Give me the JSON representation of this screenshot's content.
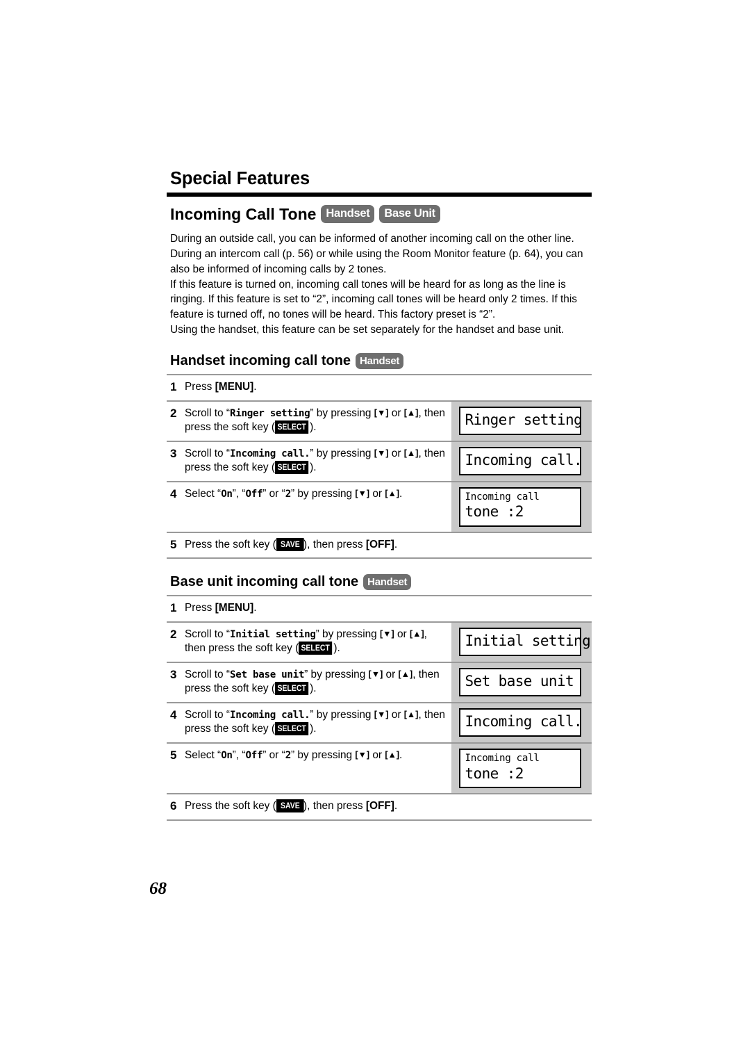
{
  "document": {
    "chapter_title": "Special Features",
    "page_number": "68"
  },
  "section": {
    "title": "Incoming Call Tone",
    "badges": [
      "Handset",
      "Base Unit"
    ],
    "paragraphs": [
      "During an outside call, you can be informed of another incoming call on the other line.",
      "During an intercom call (p. 56) or while using the Room Monitor feature (p. 64), you can also be informed of incoming calls by 2 tones.",
      "If this feature is turned on, incoming call tones will be heard for as long as the line is ringing. If this feature is set to “2”, incoming call tones will be heard only 2 times. If this feature is turned off, no tones will be heard. This factory preset is “2”.",
      "Using the handset, this feature can be set separately for the handset and base unit."
    ]
  },
  "subsections": [
    {
      "heading": "Handset incoming call tone",
      "badge": "Handset",
      "steps": [
        {
          "num": "1",
          "text_parts": {
            "lead": "Press ",
            "key": "[MENU]",
            "tail": "."
          },
          "lcd": null
        },
        {
          "num": "2",
          "scroll_target": "Ringer setting",
          "softkey": "SELECT",
          "lcd": {
            "type": "one-line",
            "line1": "Ringer setting"
          }
        },
        {
          "num": "3",
          "scroll_target": "Incoming call.",
          "softkey": "SELECT",
          "lcd": {
            "type": "one-line",
            "line1": "Incoming call."
          }
        },
        {
          "num": "4",
          "options": [
            "On",
            "Off",
            "2"
          ],
          "lcd": {
            "type": "two-line",
            "line1": "Incoming call",
            "line2": "tone :2"
          }
        },
        {
          "num": "5",
          "softkey": "SAVE",
          "end_key": "[OFF]",
          "lcd": null
        }
      ]
    },
    {
      "heading": "Base unit incoming call tone",
      "badge": "Handset",
      "steps": [
        {
          "num": "1",
          "text_parts": {
            "lead": "Press ",
            "key": "[MENU]",
            "tail": "."
          },
          "lcd": null
        },
        {
          "num": "2",
          "scroll_target": "Initial setting",
          "softkey": "SELECT",
          "lcd": {
            "type": "one-line",
            "line1": "Initial setting"
          }
        },
        {
          "num": "3",
          "scroll_target": "Set base unit",
          "softkey": "SELECT",
          "lcd": {
            "type": "one-line",
            "line1": "Set base unit"
          }
        },
        {
          "num": "4",
          "scroll_target": "Incoming call.",
          "softkey": "SELECT",
          "lcd": {
            "type": "one-line",
            "line1": "Incoming call."
          }
        },
        {
          "num": "5",
          "options": [
            "On",
            "Off",
            "2"
          ],
          "lcd": {
            "type": "two-line",
            "line1": "Incoming call",
            "line2": "tone :2"
          }
        },
        {
          "num": "6",
          "softkey": "SAVE",
          "end_key": "[OFF]",
          "lcd": null
        }
      ]
    }
  ],
  "phrases": {
    "press": "Press ",
    "scroll_to": "Scroll to ",
    "by_pressing": " by pressing ",
    "or": " or ",
    "then_press_soft_key": ", then press the soft key (",
    "close_paren_period": ").",
    "select_label": "Select ",
    "select_tail": " by pressing ",
    "press_soft_key": "Press the soft key (",
    "then_press": "), then press ",
    "period": ".",
    "down_key": "[▼]",
    "up_key": "[▲]",
    "quote_open": "“",
    "quote_close": "”",
    "comma": ", "
  },
  "colors": {
    "badge_bg": "#6e6e6e",
    "lcd_column_bg": "#c9c9c9",
    "rule": "#9a9a9a",
    "chapter_rule": "#000000"
  }
}
